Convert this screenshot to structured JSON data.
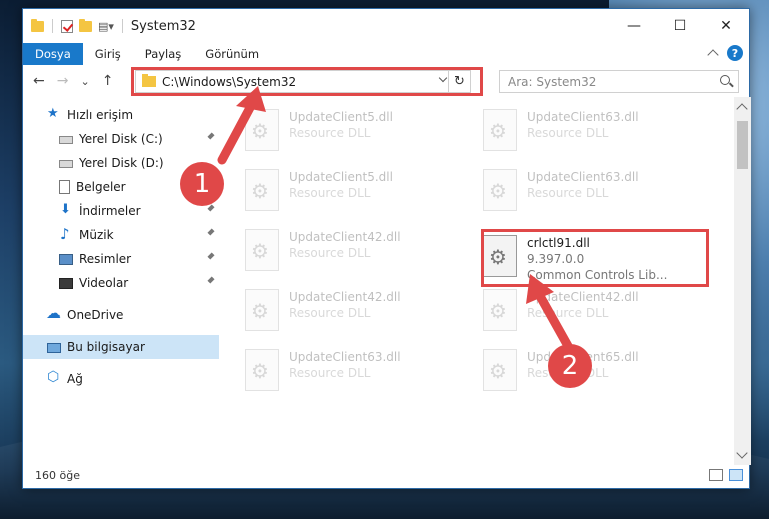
{
  "window": {
    "title": "System32",
    "controls": {
      "minimize": "—",
      "maximize": "☐",
      "close": "✕"
    }
  },
  "ribbon": {
    "tabs": [
      "Dosya",
      "Giriş",
      "Paylaş",
      "Görünüm"
    ]
  },
  "address": {
    "path": "C:\\Windows\\System32",
    "refresh_glyph": "↻"
  },
  "search": {
    "placeholder": "Ara: System32"
  },
  "navigation": {
    "back": "←",
    "forward": "→",
    "recent": "⌄",
    "up": "↑"
  },
  "sidebar": {
    "items": [
      {
        "label": "Hızlı erişim",
        "icon": "star-icon"
      },
      {
        "label": "Yerel Disk (C:)",
        "icon": "drive-icon",
        "pinned": true
      },
      {
        "label": "Yerel Disk (D:)",
        "icon": "drive-icon"
      },
      {
        "label": "Belgeler",
        "icon": "documents-icon",
        "pinned": true
      },
      {
        "label": "İndirmeler",
        "icon": "download-icon",
        "pinned": true
      },
      {
        "label": "Müzik",
        "icon": "music-icon",
        "pinned": true
      },
      {
        "label": "Resimler",
        "icon": "pictures-icon",
        "pinned": true
      },
      {
        "label": "Videolar",
        "icon": "videos-icon",
        "pinned": true
      },
      {
        "label": "OneDrive",
        "icon": "cloud-icon"
      },
      {
        "label": "Bu bilgisayar",
        "icon": "computer-icon",
        "selected": true
      },
      {
        "label": "Ağ",
        "icon": "network-icon"
      }
    ]
  },
  "files": [
    {
      "name": "UpdateClient5.dll",
      "type": "Resource DLL"
    },
    {
      "name": "UpdateClient63.dll",
      "type": "Resource DLL"
    },
    {
      "name": "UpdateClient5.dll",
      "type": "Resource DLL"
    },
    {
      "name": "UpdateClient63.dll",
      "type": "Resource DLL"
    },
    {
      "name": "UpdateClient42.dll",
      "type": "Resource DLL"
    },
    {
      "name": "crlctl91.dll",
      "version": "9.397.0.0",
      "type": "Common Controls Lib..."
    },
    {
      "name": "UpdateClient42.dll",
      "type": "Resource DLL"
    },
    {
      "name": "UpdateClient42.dll",
      "type": "Resource DLL"
    },
    {
      "name": "UpdateClient63.dll",
      "type": "Resource DLL"
    },
    {
      "name": "UpdateClient65.dll",
      "type": "Resource DLL"
    }
  ],
  "status": {
    "item_count": "160 öğe"
  },
  "annotations": {
    "step1": "1",
    "step2": "2",
    "color": "#e04848"
  }
}
